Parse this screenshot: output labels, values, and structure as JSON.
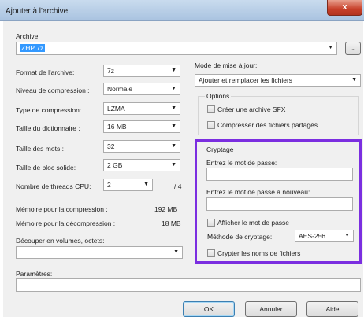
{
  "window": {
    "title": "Ajouter à l'archive",
    "close_glyph": "x"
  },
  "archive": {
    "label": "Archive:",
    "value": "ZHP 7z",
    "browse_label": "..."
  },
  "left": {
    "format_label": "Format de l'archive:",
    "format_value": "7z",
    "level_label": "Niveau de compression :",
    "level_value": "Normale",
    "type_label": "Type de compression:",
    "type_value": "LZMA",
    "dict_label": "Taille du dictionnaire :",
    "dict_value": "16 MB",
    "word_label": "Taille des mots :",
    "word_value": "32",
    "solid_label": "Taille de bloc solide:",
    "solid_value": "2 GB",
    "threads_label": "Nombre de threads CPU:",
    "threads_value": "2",
    "threads_max": "/ 4",
    "mem_comp_label": "Mémoire pour la compression :",
    "mem_comp_value": "192 MB",
    "mem_decomp_label": "Mémoire pour la décompression :",
    "mem_decomp_value": "18 MB",
    "split_label": "Découper en volumes, octets:"
  },
  "right": {
    "update_label": "Mode de mise à jour:",
    "update_value": "Ajouter et remplacer les fichiers",
    "options_label": "Options",
    "sfx_label": "Créer une archive SFX",
    "shared_label": "Compresser des fichiers partagés"
  },
  "crypto": {
    "group_label": "Cryptage",
    "password_label": "Entrez le mot de passe:",
    "password_again_label": "Entrez le mot de passe à nouveau:",
    "show_label": "Afficher le mot de passe",
    "method_label": "Méthode de cryptage:",
    "method_value": "AES-256",
    "encrypt_names_label": "Crypter les noms de fichiers"
  },
  "params": {
    "label": "Paramètres:"
  },
  "buttons": {
    "ok": "OK",
    "cancel": "Annuler",
    "help": "Aide"
  },
  "colors": {
    "highlight": "#7b2ee0",
    "title_gradient_top": "#c9dbee",
    "close_red": "#c7402a"
  }
}
